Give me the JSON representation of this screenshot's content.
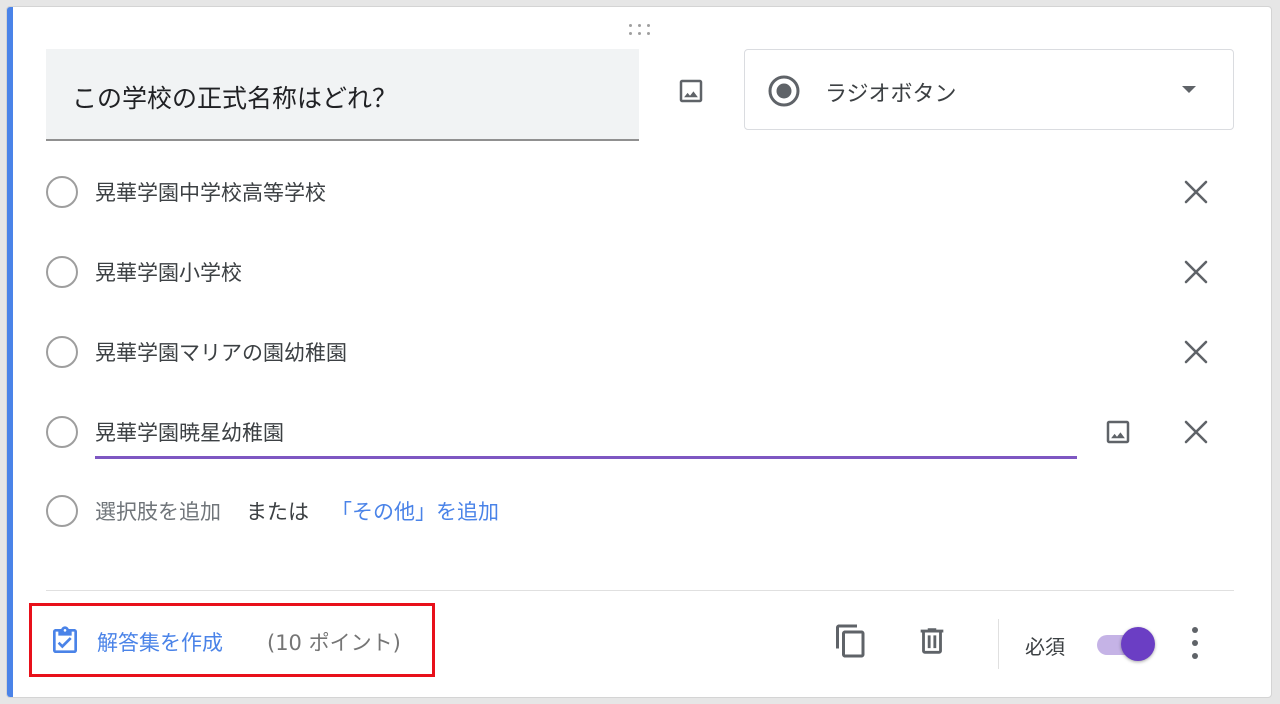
{
  "question": {
    "title": "この学校の正式名称はどれ？",
    "type_label": "ラジオボタン",
    "image_icon": "image-icon"
  },
  "options": [
    {
      "label": "晃華学園中学校高等学校"
    },
    {
      "label": "晃華学園小学校"
    },
    {
      "label": "晃華学園マリアの園幼稚園"
    },
    {
      "label": "晃華学園暁星幼稚園"
    }
  ],
  "add_option": {
    "label": "選択肢を追加",
    "or_text": "または",
    "other_link": "「その他」を追加"
  },
  "footer": {
    "answer_key_label": "解答集を作成",
    "points": "(10 ポイント)",
    "required_label": "必須",
    "required_on": true
  },
  "colors": {
    "accent": "#4a83e8",
    "toggle": "#6b3ec4",
    "active_underline": "#7e57c2",
    "highlight": "#e8101a"
  }
}
